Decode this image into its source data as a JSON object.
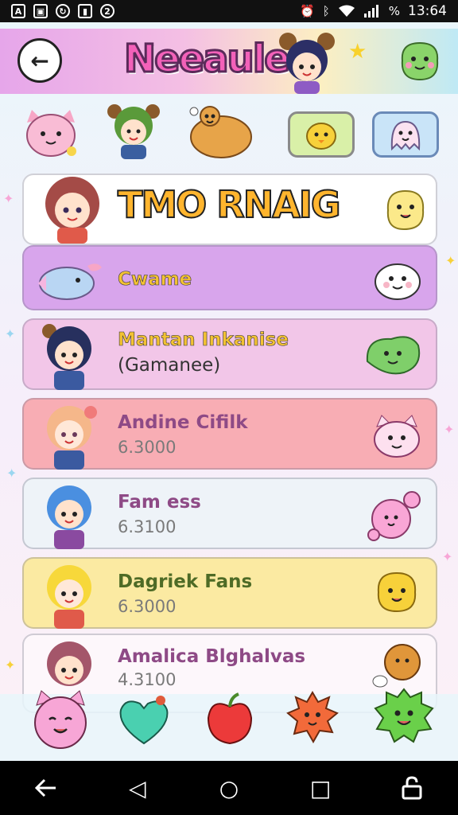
{
  "status_bar": {
    "left_icons": [
      "notification-a-icon",
      "image-icon",
      "sync-icon",
      "sim-icon",
      "message-icon"
    ],
    "right_icons": [
      "alarm-icon",
      "bluetooth-icon",
      "wifi-icon",
      "signal-icon"
    ],
    "battery": "%",
    "time": "13:64"
  },
  "header": {
    "title": "Neeaule",
    "back_icon": "back-arrow-icon"
  },
  "feature_card": {
    "title": "TMO RNAIG"
  },
  "cards": [
    {
      "name": "Cwame",
      "sub": "",
      "bg": "#d8a5ec",
      "name_color": "#f3c233"
    },
    {
      "name": "Mantan Inkanise",
      "sub": "(Gamanee)",
      "bg": "#f2c6e8",
      "name_color": "#f3c233"
    },
    {
      "name": "Andine Cifilk",
      "sub": "6.3000",
      "bg": "#f8adb4",
      "name_color": "#8e4a86"
    },
    {
      "name": "Fam ess",
      "sub": "6.3100",
      "bg": "#eef3f8",
      "name_color": "#8e4a86"
    },
    {
      "name": "Dagriek Fans",
      "sub": "6.3000",
      "bg": "#fbeaa2",
      "name_color": "#4e6b26"
    },
    {
      "name": "Amalica Blghalvas",
      "sub": "4.3100",
      "bg": "#fdf7fb",
      "name_color": "#8e4a86"
    }
  ],
  "nav": {
    "back": "◁",
    "home": "○",
    "recents": "□"
  },
  "colors": {
    "accent_pink": "#f361b9",
    "status_bg": "#111111",
    "nav_bg": "#000000"
  }
}
